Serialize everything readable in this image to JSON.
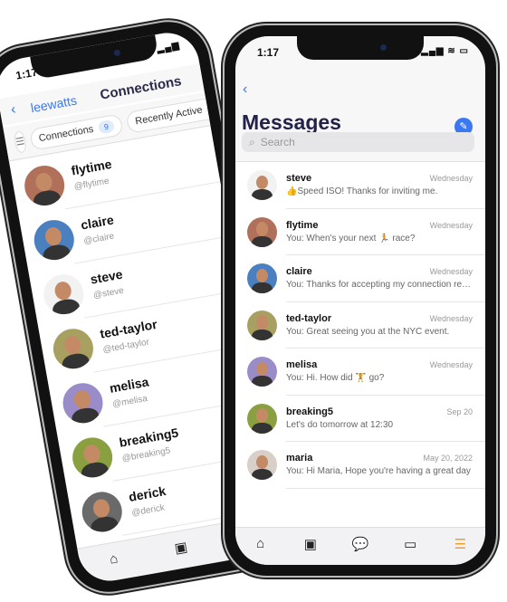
{
  "connections_screen": {
    "status_time": "1:17",
    "back_label": "leewatts",
    "title": "Connections",
    "filter_chip": {
      "label": "Connections",
      "count": "9"
    },
    "sort_dropdown": "Recently Active",
    "items": [
      {
        "name": "flytime",
        "handle": "@flytime",
        "color": "#b0705a"
      },
      {
        "name": "claire",
        "handle": "@claire",
        "color": "#4a7fc0"
      },
      {
        "name": "steve",
        "handle": "@steve",
        "color": "#f2f2f2"
      },
      {
        "name": "ted-taylor",
        "handle": "@ted-taylor",
        "color": "#a8a060"
      },
      {
        "name": "melisa",
        "handle": "@melisa",
        "color": "#9a8cc8"
      },
      {
        "name": "breaking5",
        "handle": "@breaking5",
        "color": "#8aa040"
      },
      {
        "name": "derick",
        "handle": "@derick",
        "color": "#6a6a6a"
      }
    ]
  },
  "messages_screen": {
    "status_time": "1:17",
    "title": "Messages",
    "search_placeholder": "Search",
    "accent": "#3a78f2",
    "conversations": [
      {
        "name": "steve",
        "time": "Wednesday",
        "preview": "👍Speed ISO! Thanks for inviting me.",
        "color": "#f2f2f2"
      },
      {
        "name": "flytime",
        "time": "Wednesday",
        "preview": "You: When's your next 🏃 race?",
        "color": "#b0705a"
      },
      {
        "name": "claire",
        "time": "Wednesday",
        "preview": "You: Thanks for accepting my connection request",
        "color": "#4a7fc0"
      },
      {
        "name": "ted-taylor",
        "time": "Wednesday",
        "preview": "You: Great seeing you at the NYC event.",
        "color": "#a8a060"
      },
      {
        "name": "melisa",
        "time": "Wednesday",
        "preview": "You: Hi. How did 🏋 go?",
        "color": "#9a8cc8"
      },
      {
        "name": "breaking5",
        "time": "Sep 20",
        "preview": "Let's do tomorrow at 12:30",
        "color": "#8aa040"
      },
      {
        "name": "maria",
        "time": "May 20, 2022",
        "preview": "You: Hi Maria, Hope you're having a great day",
        "color": "#d8cfc8"
      }
    ],
    "tabs": [
      {
        "icon": "home-icon",
        "glyph": "⌂"
      },
      {
        "icon": "activity-icon",
        "glyph": "▣"
      },
      {
        "icon": "chat-icon",
        "glyph": "💬"
      },
      {
        "icon": "calendar-icon",
        "glyph": "▭"
      },
      {
        "icon": "menu-icon",
        "glyph": "☰",
        "active": true
      }
    ]
  }
}
